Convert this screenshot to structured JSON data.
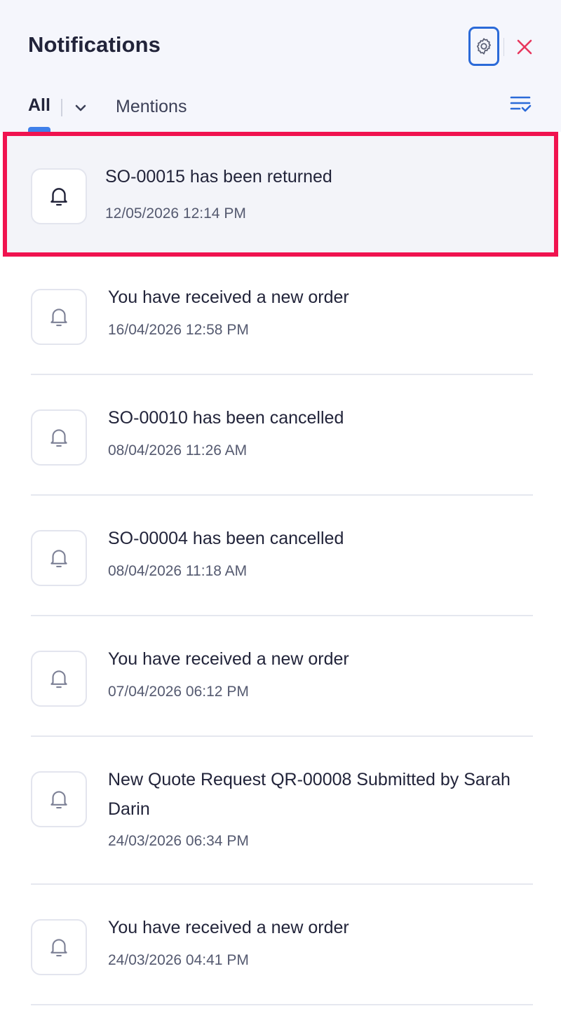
{
  "header": {
    "title": "Notifications",
    "settings_icon": "gear-icon",
    "close_icon": "close-icon",
    "close_color": "#e8365d"
  },
  "tabs": {
    "all_label": "All",
    "mentions_label": "Mentions",
    "active_color": "#3f80ea"
  },
  "notifications": [
    {
      "message": "SO-00015 has been returned",
      "time": "12/05/2026 12:14 PM",
      "selected": true
    },
    {
      "message": "You have received a new order",
      "time": "16/04/2026 12:58 PM"
    },
    {
      "message": "SO-00010 has been cancelled",
      "time": "08/04/2026 11:26 AM"
    },
    {
      "message": "SO-00004 has been cancelled",
      "time": "08/04/2026 11:18 AM"
    },
    {
      "message": "You have received a new order",
      "time": "07/04/2026 06:12 PM"
    },
    {
      "message": "New Quote Request QR-00008 Submitted by Sarah Darin",
      "time": "24/03/2026 06:34 PM"
    },
    {
      "message": "You have received a new order",
      "time": "24/03/2026 04:41 PM"
    }
  ]
}
